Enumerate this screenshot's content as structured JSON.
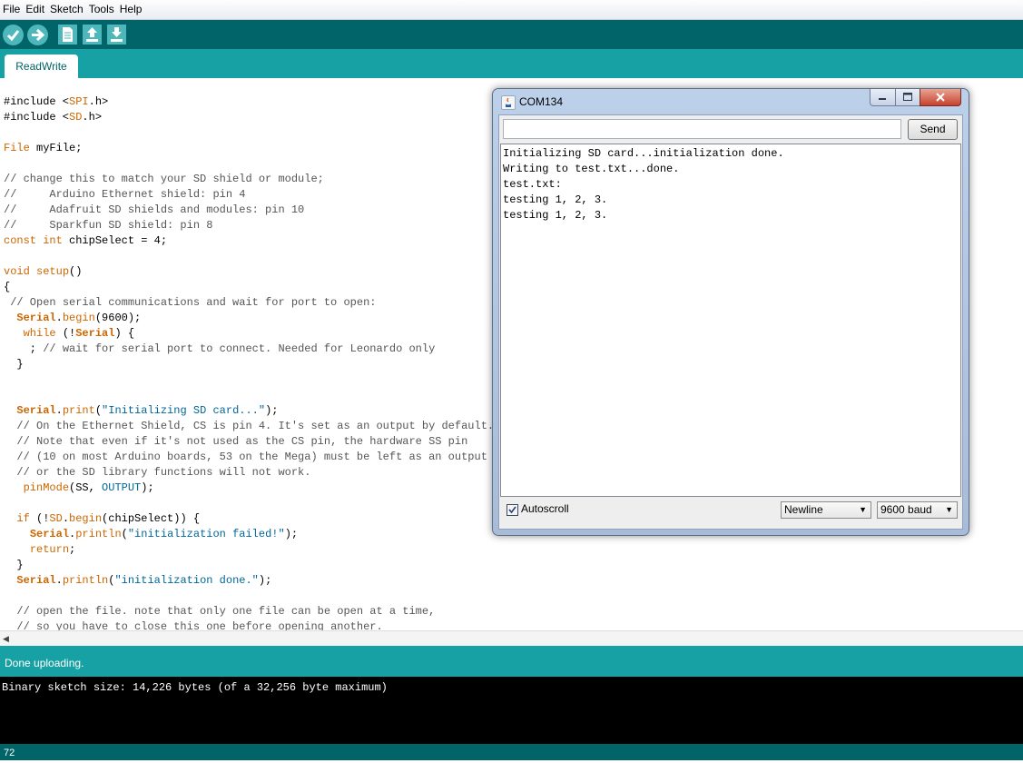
{
  "menu": [
    "File",
    "Edit",
    "Sketch",
    "Tools",
    "Help"
  ],
  "toolbar": {
    "verify_icon": "checkmark-icon",
    "upload_icon": "arrow-right-icon",
    "new_icon": "new-file-icon",
    "open_icon": "open-up-arrow-icon",
    "save_icon": "save-down-arrow-icon"
  },
  "tab": {
    "label": "ReadWrite"
  },
  "editor": {
    "lines": [
      "#include <SPI.h>",
      "#include <SD.h>",
      "",
      "File myFile;",
      "",
      "// change this to match your SD shield or module;",
      "//     Arduino Ethernet shield: pin 4",
      "//     Adafruit SD shields and modules: pin 10",
      "//     Sparkfun SD shield: pin 8",
      "const int chipSelect = 4;",
      "",
      "void setup()",
      "{",
      " // Open serial communications and wait for port to open:",
      "  Serial.begin(9600);",
      "   while (!Serial) {",
      "    ; // wait for serial port to connect. Needed for Leonardo only",
      "  }",
      "",
      "",
      "  Serial.print(\"Initializing SD card...\");",
      "  // On the Ethernet Shield, CS is pin 4. It's set as an output by default.",
      "  // Note that even if it's not used as the CS pin, the hardware SS pin",
      "  // (10 on most Arduino boards, 53 on the Mega) must be left as an output",
      "  // or the SD library functions will not work.",
      "   pinMode(SS, OUTPUT);",
      "",
      "  if (!SD.begin(chipSelect)) {",
      "    Serial.println(\"initialization failed!\");",
      "    return;",
      "  }",
      "  Serial.println(\"initialization done.\");",
      "",
      "  // open the file. note that only one file can be open at a time,",
      "  // so you have to close this one before opening another."
    ]
  },
  "status": {
    "message": "Done uploading."
  },
  "console": {
    "text": "Binary sketch size: 14,226 bytes (of a 32,256 byte maximum)"
  },
  "footer": {
    "line_number": "72"
  },
  "serial_monitor": {
    "title": "COM134",
    "title_icon": "java-icon",
    "input_value": "",
    "send_label": "Send",
    "output_lines": [
      "Initializing SD card...initialization done.",
      "Writing to test.txt...done.",
      "test.txt:",
      "testing 1, 2, 3.",
      "testing 1, 2, 3."
    ],
    "autoscroll_label": "Autoscroll",
    "autoscroll_checked": true,
    "line_ending": "Newline",
    "baud_rate": "9600 baud"
  },
  "colors": {
    "toolbar_dark": "#006468",
    "tabstrip": "#17a1a5",
    "keyword_orange": "#cc6600",
    "string_blue": "#006699"
  }
}
